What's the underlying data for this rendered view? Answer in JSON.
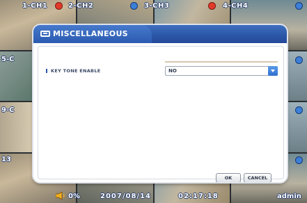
{
  "channels": [
    {
      "label": "1-CH1",
      "dot": "red"
    },
    {
      "label": "2-CH2",
      "dot": "blue"
    },
    {
      "label": "3-CH3",
      "dot": "red"
    },
    {
      "label": "4-CH4",
      "dot": "blue"
    }
  ],
  "side_labels": [
    "5-C",
    "9-C",
    "13"
  ],
  "status": {
    "hdd_usage": "0%",
    "date": "2007/08/14",
    "time": "02:17:18",
    "user": "admin"
  },
  "dialog": {
    "title": "MISCELLANEOUS",
    "settings": [
      {
        "label": "KEY TONE ENABLE",
        "value": "NO"
      }
    ],
    "ok_label": "OK",
    "cancel_label": "CANCEL"
  },
  "colors": {
    "accent": "#2a56a6",
    "record_red": "#e23a2a",
    "dropdown_blue": "#2f6fd0"
  },
  "icons": [
    "speaker-icon",
    "menu-icon",
    "chevron-down-icon"
  ]
}
